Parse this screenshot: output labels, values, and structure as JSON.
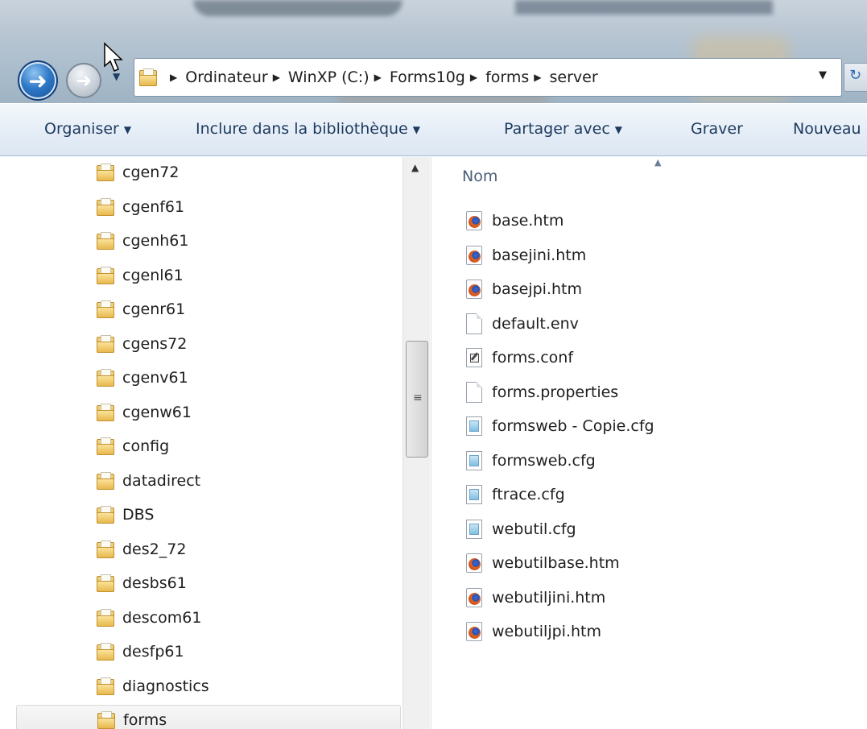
{
  "address_bar": {
    "crumbs": [
      "Ordinateur",
      "WinXP (C:)",
      "Forms10g",
      "forms",
      "server"
    ]
  },
  "toolbar": {
    "organise": "Organiser",
    "include": "Inclure dans la bibliothèque",
    "share": "Partager avec",
    "burn": "Graver",
    "new": "Nouveau"
  },
  "nav_pane": {
    "folders": [
      "cgen72",
      "cgenf61",
      "cgenh61",
      "cgenl61",
      "cgenr61",
      "cgens72",
      "cgenv61",
      "cgenw61",
      "config",
      "datadirect",
      "DBS",
      "des2_72",
      "desbs61",
      "descom61",
      "desfp61",
      "diagnostics",
      "forms"
    ],
    "selected": "forms"
  },
  "content": {
    "column_header": "Nom",
    "files": [
      {
        "name": "base.htm",
        "icon": "firefox-html-icon"
      },
      {
        "name": "basejini.htm",
        "icon": "firefox-html-icon"
      },
      {
        "name": "basejpi.htm",
        "icon": "firefox-html-icon"
      },
      {
        "name": "default.env",
        "icon": "blank-file-icon"
      },
      {
        "name": "forms.conf",
        "icon": "conf-file-icon"
      },
      {
        "name": "forms.properties",
        "icon": "blank-file-icon"
      },
      {
        "name": "formsweb - Copie.cfg",
        "icon": "cfg-file-icon"
      },
      {
        "name": "formsweb.cfg",
        "icon": "cfg-file-icon"
      },
      {
        "name": "ftrace.cfg",
        "icon": "cfg-file-icon"
      },
      {
        "name": "webutil.cfg",
        "icon": "cfg-file-icon"
      },
      {
        "name": "webutilbase.htm",
        "icon": "firefox-html-icon"
      },
      {
        "name": "webutiljini.htm",
        "icon": "firefox-html-icon"
      },
      {
        "name": "webutiljpi.htm",
        "icon": "firefox-html-icon"
      }
    ]
  },
  "colors": {
    "toolbar_text": "#1e3a5f",
    "header_text": "#4c607a",
    "selected_bg": "#ebebeb"
  }
}
